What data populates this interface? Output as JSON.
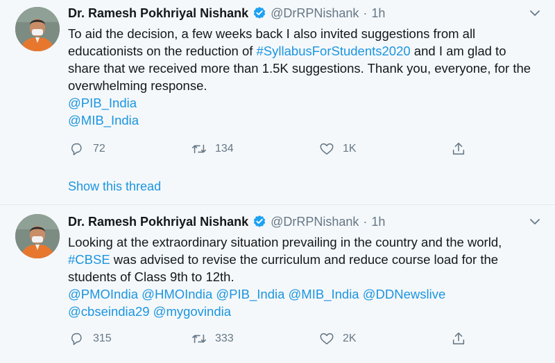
{
  "tweets": [
    {
      "author": {
        "name": "Dr. Ramesh Pokhriyal Nishank",
        "handle": "@DrRPNishank"
      },
      "separator": "·",
      "time": "1h",
      "text_parts": [
        {
          "t": "To aid the decision, a few weeks back I also invited suggestions from all educationists on the reduction of ",
          "link": false
        },
        {
          "t": "#SyllabusForStudents2020",
          "link": true
        },
        {
          "t": " and I am glad to share that we received more than 1.5K suggestions. Thank you, everyone, for the overwhelming response.",
          "link": false
        }
      ],
      "mention_lines": [
        "@PIB_India",
        "@MIB_India"
      ],
      "counts": {
        "replies": "72",
        "retweets": "134",
        "likes": "1K"
      },
      "show_thread": "Show this thread"
    },
    {
      "author": {
        "name": "Dr. Ramesh Pokhriyal Nishank",
        "handle": "@DrRPNishank"
      },
      "separator": "·",
      "time": "1h",
      "text_parts": [
        {
          "t": "Looking at the extraordinary situation prevailing in the country and the world, ",
          "link": false
        },
        {
          "t": "#CBSE",
          "link": true
        },
        {
          "t": " was advised to revise the curriculum and reduce course load for the students of Class 9th to 12th.",
          "link": false
        }
      ],
      "mention_lines": [
        "@PMOIndia @HMOIndia @PIB_India @MIB_India @DDNewslive",
        "@cbseindia29 @mygovindia"
      ],
      "counts": {
        "replies": "315",
        "retweets": "333",
        "likes": "2K"
      }
    }
  ],
  "icons": {
    "reply": "speech-bubble",
    "retweet": "retweet-arrows",
    "like": "heart-outline",
    "share": "share-arrow-up",
    "verified": "verified-badge",
    "caret": "chevron-down"
  },
  "colors": {
    "background": "#f5f8fa",
    "link": "#1b95e0",
    "verified": "#1da1f2",
    "secondary_text": "#657786",
    "divider": "#e1e8ed"
  }
}
